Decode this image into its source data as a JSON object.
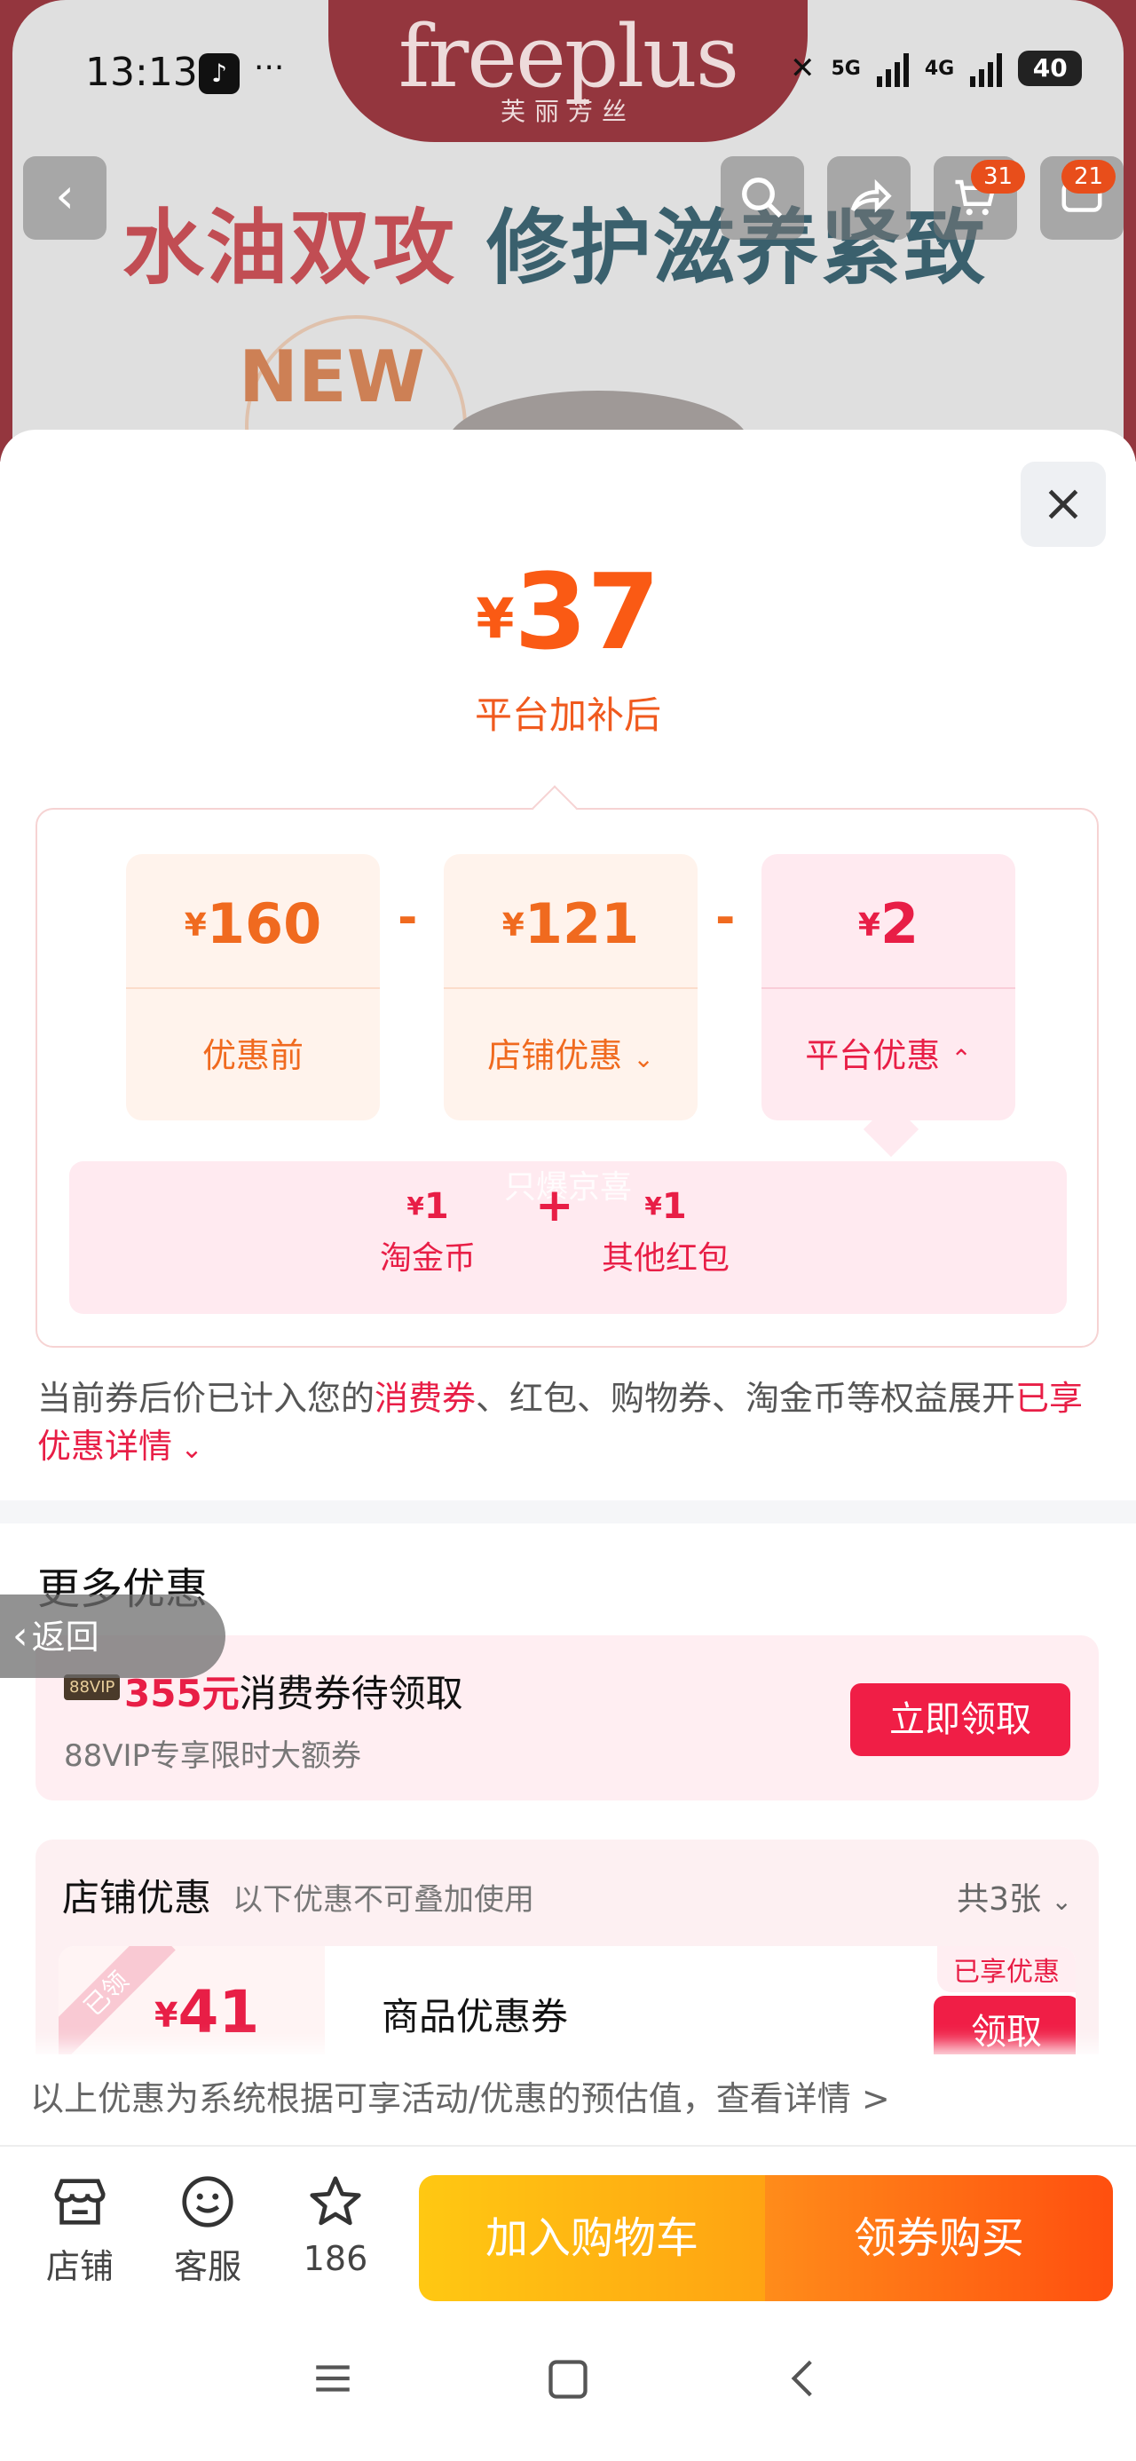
{
  "status_bar": {
    "time": "13:13",
    "app_icon": "tiktok-icon",
    "dots": "···",
    "network_1": "5G",
    "network_2": "4G",
    "battery": "40"
  },
  "background": {
    "brand": "freeplus",
    "brand_sub": "芙丽芳丝",
    "headline_part1": "水油双攻",
    "headline_part2": "修护滋养紧致",
    "new_tag": "NEW",
    "cart_badge": "31",
    "message_badge": "21"
  },
  "price": {
    "currency": "¥",
    "final": "37",
    "final_label": "平台加补后"
  },
  "breakdown": {
    "cards": [
      {
        "value": "160",
        "label": "优惠前"
      },
      {
        "value": "121",
        "label": "店铺优惠"
      },
      {
        "value": "2",
        "label": "平台优惠"
      }
    ],
    "operator": "-",
    "platform_items": [
      {
        "value": "1",
        "label": "淘金币"
      },
      {
        "value": "1",
        "label": "其他红包"
      }
    ],
    "plus": "+",
    "watermark": "只爆京喜"
  },
  "note": {
    "prefix": "当前券后价已计入您的",
    "highlight": "消费券",
    "middle": "、红包、购物券、淘金币等权益展开",
    "link": "已享优惠详情"
  },
  "more": {
    "title": "更多优惠",
    "back_label": "返回",
    "vip": {
      "badge": "88VIP",
      "amount": "355元",
      "title_rest": "消费券待领取",
      "subtitle": "88VIP专享限时大额券",
      "button": "立即领取"
    },
    "store": {
      "title": "店铺优惠",
      "subtitle": "以下优惠不可叠加使用",
      "count": "共3张",
      "coupon": {
        "ribbon": "已领",
        "value": "41",
        "name": "商品优惠券",
        "tag": "已享优惠",
        "button": "领取"
      }
    },
    "estimate": "以上优惠为系统根据可享活动/优惠的预估值，查看详情 >"
  },
  "bottom_bar": {
    "store": "店铺",
    "service": "客服",
    "favorites": "186",
    "add_to_cart": "加入购物车",
    "buy": "领券购买"
  },
  "colors": {
    "accent_orange": "#fa5a14",
    "accent_red": "#e81e46"
  }
}
